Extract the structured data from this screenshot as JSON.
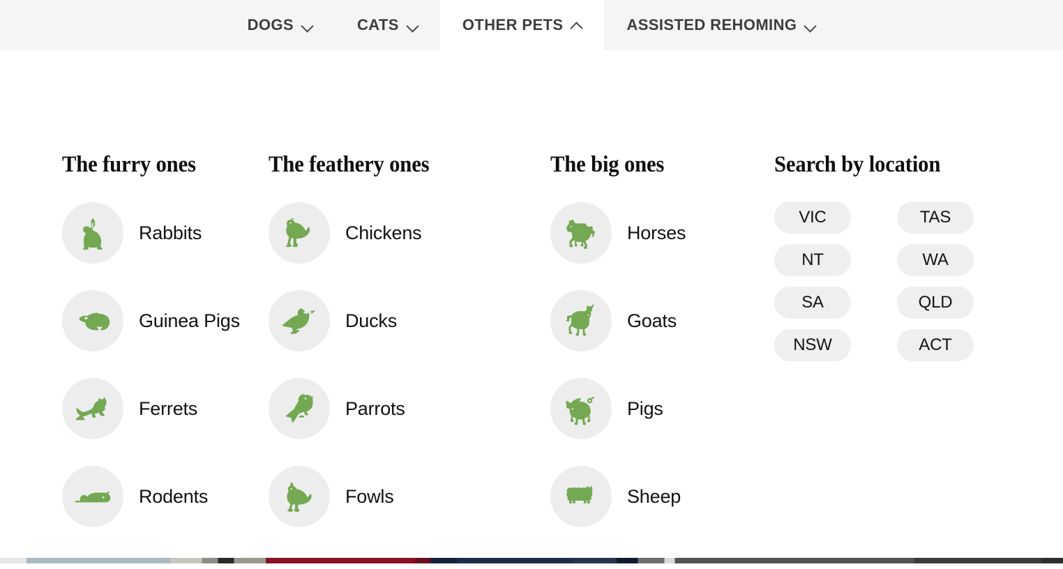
{
  "navbar": {
    "tabs": [
      {
        "label": "DOGS",
        "icon": "chevron-down-icon",
        "active": false,
        "expanded": false
      },
      {
        "label": "CATS",
        "icon": "chevron-down-icon",
        "active": false,
        "expanded": false
      },
      {
        "label": "OTHER PETS",
        "icon": "chevron-up-icon",
        "active": true,
        "expanded": true
      },
      {
        "label": "ASSISTED REHOMING",
        "icon": "chevron-down-icon",
        "active": false,
        "expanded": false
      }
    ]
  },
  "panel": {
    "columns": [
      {
        "title": "The furry ones",
        "items": [
          {
            "label": "Rabbits",
            "icon": "rabbit-icon"
          },
          {
            "label": "Guinea Pigs",
            "icon": "guinea-pig-icon"
          },
          {
            "label": "Ferrets",
            "icon": "ferret-icon"
          },
          {
            "label": "Rodents",
            "icon": "rodent-icon"
          }
        ]
      },
      {
        "title": "The feathery ones",
        "items": [
          {
            "label": "Chickens",
            "icon": "chicken-icon"
          },
          {
            "label": "Ducks",
            "icon": "duck-icon"
          },
          {
            "label": "Parrots",
            "icon": "parrot-icon"
          },
          {
            "label": "Fowls",
            "icon": "fowl-icon"
          }
        ]
      },
      {
        "title": "The big ones",
        "items": [
          {
            "label": "Horses",
            "icon": "horse-icon"
          },
          {
            "label": "Goats",
            "icon": "goat-icon"
          },
          {
            "label": "Pigs",
            "icon": "pig-icon"
          },
          {
            "label": "Sheep",
            "icon": "sheep-icon"
          }
        ]
      }
    ],
    "location": {
      "title": "Search by location",
      "pills": [
        "VIC",
        "NT",
        "SA",
        "NSW",
        "TAS",
        "WA",
        "QLD",
        "ACT"
      ]
    }
  },
  "colors": {
    "icon_green": "#74a852",
    "icon_circle_bg": "#ededed",
    "navbar_bg": "#f5f5f5",
    "active_tab_bg": "#ffffff",
    "pill_bg": "#efefef",
    "heading_text": "#0f0f0f",
    "nav_text": "#3d3d3d"
  }
}
